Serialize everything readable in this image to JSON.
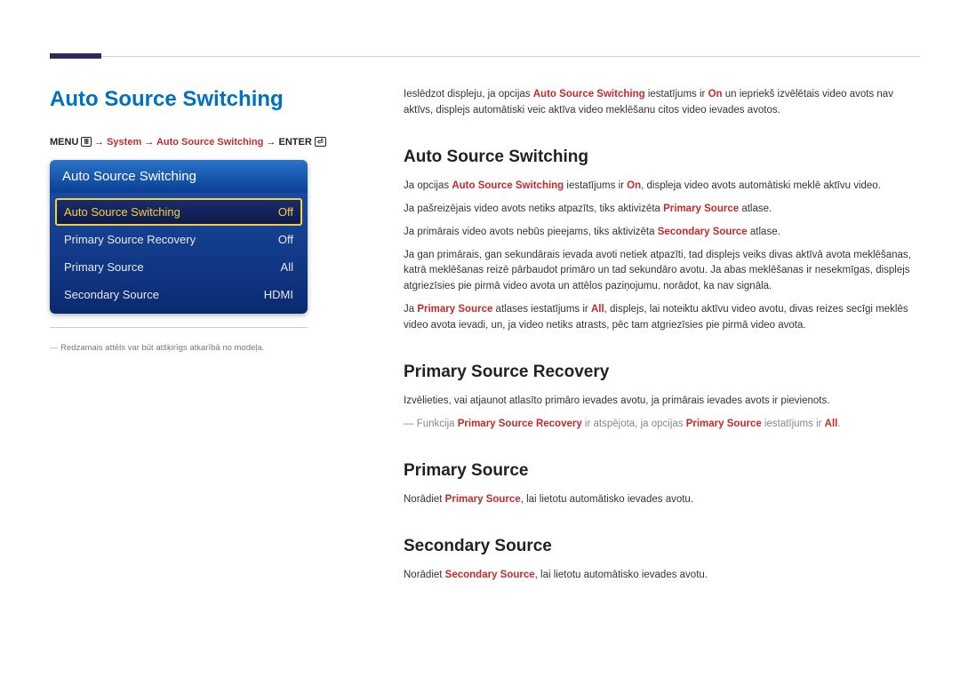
{
  "page": {
    "title": "Auto Source Switching"
  },
  "breadcrumb": {
    "menu": "MENU",
    "arrow": "→",
    "system": "System",
    "section": "Auto Source Switching",
    "enter": "ENTER"
  },
  "menu_panel": {
    "header": "Auto Source Switching",
    "rows": [
      {
        "label": "Auto Source Switching",
        "value": "Off",
        "selected": true
      },
      {
        "label": "Primary Source Recovery",
        "value": "Off",
        "selected": false
      },
      {
        "label": "Primary Source",
        "value": "All",
        "selected": false
      },
      {
        "label": "Secondary Source",
        "value": "HDMI",
        "selected": false
      }
    ]
  },
  "note": "Redzamais attēls var būt atšķirīgs atkarībā no modeļa.",
  "content": {
    "intro_pre": "Ieslēdzot displeju, ja opcijas ",
    "intro_hl1": "Auto Source Switching",
    "intro_mid1": " iestatījums ir ",
    "intro_hl2": "On",
    "intro_post": " un iepriekš izvēlētais video avots nav aktīvs, displejs automātiski veic aktīva video meklēšanu citos video ievades avotos.",
    "h1": "Auto Source Switching",
    "p1_pre": "Ja opcijas ",
    "p1_hl1": "Auto Source Switching",
    "p1_mid": " iestatījums ir ",
    "p1_hl2": "On",
    "p1_post": ", displeja video avots automātiski meklē aktīvu video.",
    "p2_pre": "Ja pašreizējais video avots netiks atpazīts, tiks aktivizēta ",
    "p2_hl": "Primary Source",
    "p2_post": " atlase.",
    "p3_pre": "Ja primārais video avots nebūs pieejams, tiks aktivizēta ",
    "p3_hl": "Secondary Source",
    "p3_post": " atlase.",
    "p4": "Ja gan primārais, gan sekundārais ievada avoti netiek atpazīti, tad displejs veiks divas aktīvā avota meklēšanas, katrā meklēšanas reizē pārbaudot primāro un tad sekundāro avotu. Ja abas meklēšanas ir nesekmīgas, displejs atgriezīsies pie pirmā video avota un attēlos paziņojumu, norādot, ka nav signāla.",
    "p5_pre": "Ja ",
    "p5_hl1": "Primary Source",
    "p5_mid1": " atlases iestatījums ir ",
    "p5_hl2": "All",
    "p5_post": ", displejs, lai noteiktu aktīvu video avotu, divas reizes secīgi meklēs video avota ievadi, un, ja video netiks atrasts, pēc tam atgriezīsies pie pirmā video avota.",
    "h2": "Primary Source Recovery",
    "p6": "Izvēlieties, vai atjaunot atlasīto primāro ievades avotu, ja primārais ievades avots ir pievienots.",
    "p7_pre": "Funkcija ",
    "p7_hl1": "Primary Source Recovery",
    "p7_mid1": " ir atspējota, ja opcijas ",
    "p7_hl2": "Primary Source",
    "p7_mid2": " iestatījums ir ",
    "p7_hl3": "All",
    "p7_post": ".",
    "h3": "Primary Source",
    "p8_pre": "Norādiet ",
    "p8_hl": "Primary Source",
    "p8_post": ", lai lietotu automātisko ievades avotu.",
    "h4": "Secondary Source",
    "p9_pre": "Norādiet ",
    "p9_hl": "Secondary Source",
    "p9_post": ", lai lietotu automātisko ievades avotu."
  }
}
